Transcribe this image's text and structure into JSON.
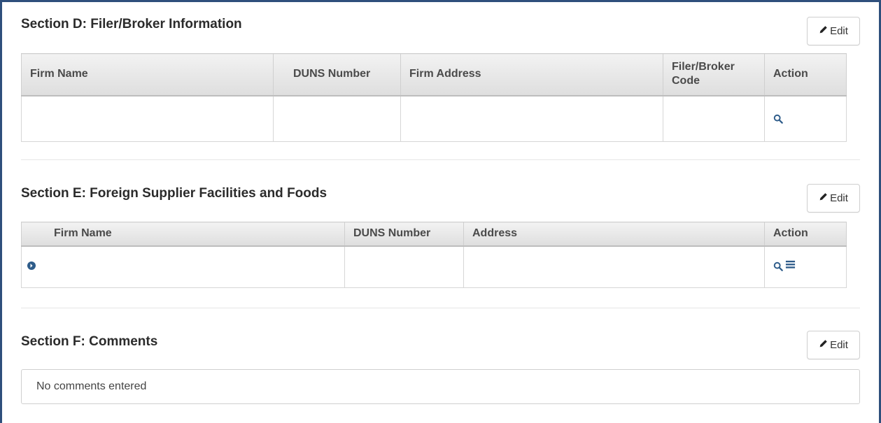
{
  "section_d": {
    "title": "Section D: Filer/Broker Information",
    "edit_label": "Edit",
    "columns": [
      "Firm Name",
      "DUNS Number",
      "Firm Address",
      "Filer/Broker Code",
      "Action"
    ],
    "row": [
      "",
      "",
      "",
      ""
    ]
  },
  "section_e": {
    "title": "Section E: Foreign Supplier Facilities and Foods",
    "edit_label": "Edit",
    "columns": [
      "Firm Name",
      "DUNS Number",
      "Address",
      "Action"
    ],
    "row": [
      "",
      "",
      ""
    ]
  },
  "section_f": {
    "title": "Section F: Comments",
    "edit_label": "Edit",
    "comment_text": "No comments entered"
  },
  "icons": {
    "edit": "pencil-icon",
    "view": "search-icon",
    "details": "list-icon",
    "expand": "circle-arrow-right-icon"
  },
  "colors": {
    "frame_border": "#2e4f7c",
    "icon_blue": "#2e5c8a"
  }
}
